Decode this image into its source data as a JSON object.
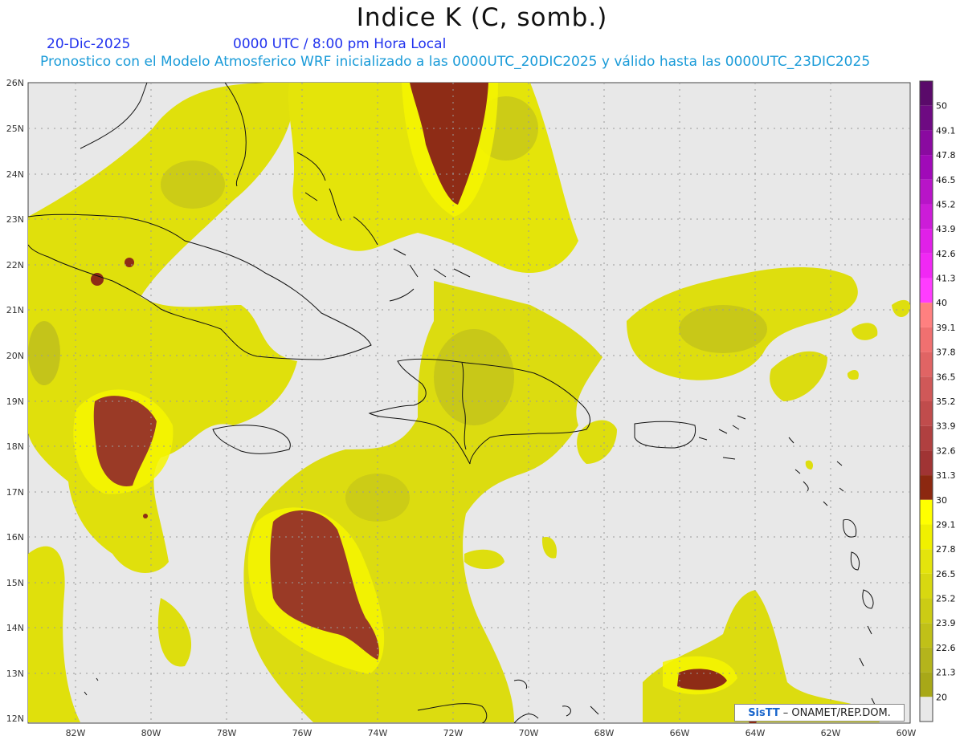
{
  "header": {
    "title": "Indice K (C, somb.)",
    "date": "20-Dic-2025",
    "valid_time": "0000 UTC / 8:00 pm Hora Local",
    "run_info": "Pronostico con el Modelo Atmosferico WRF inicializado a las 0000UTC_20DIC2025 y válido hasta las  0000UTC_23DIC2025"
  },
  "map": {
    "lat_labels": [
      "26N",
      "25N",
      "24N",
      "23N",
      "22N",
      "21N",
      "20N",
      "19N",
      "18N",
      "17N",
      "16N",
      "15N",
      "14N",
      "13N",
      "12N"
    ],
    "lon_labels": [
      "82W",
      "80W",
      "78W",
      "76W",
      "74W",
      "72W",
      "70W",
      "68W",
      "66W",
      "64W",
      "62W",
      "60W"
    ],
    "ocean_color": "#e8e8e8"
  },
  "colorbar": {
    "labels": [
      "50",
      "49.1",
      "47.8",
      "46.5",
      "45.2",
      "43.9",
      "42.6",
      "41.3",
      "40",
      "39.1",
      "37.8",
      "36.5",
      "35.2",
      "33.9",
      "32.6",
      "31.3",
      "30",
      "29.1",
      "27.8",
      "26.5",
      "25.2",
      "23.9",
      "22.6",
      "21.3",
      "20"
    ],
    "colors": [
      "#5a0a6a",
      "#6e0a82",
      "#8a0aa0",
      "#a00ab8",
      "#b814c8",
      "#cc1cd8",
      "#e020e8",
      "#f028f4",
      "#ff3cff",
      "#ff8080",
      "#f07070",
      "#e06464",
      "#d05858",
      "#c04c4c",
      "#b04040",
      "#a03434",
      "#8c2810",
      "#ffff00",
      "#f0f000",
      "#e4e40c",
      "#d8d810",
      "#cccc14",
      "#c0c018",
      "#b4b41c",
      "#a8a818"
    ]
  },
  "logo": {
    "brand": "SisTT",
    "text": "– ONAMET/REP.DOM."
  }
}
